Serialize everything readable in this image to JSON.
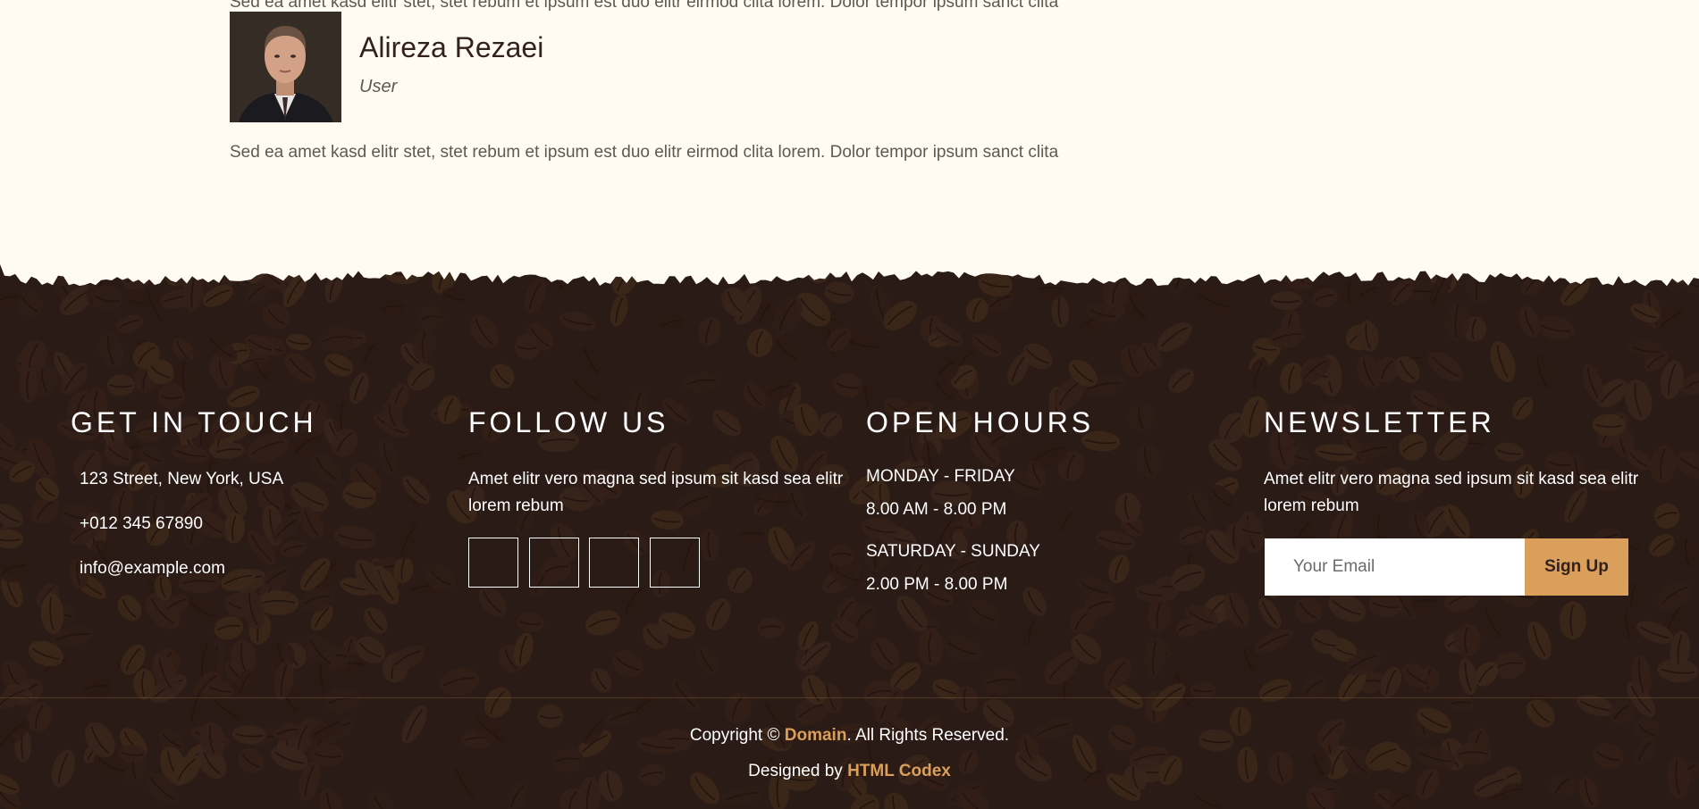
{
  "testimonial": {
    "cut_text": "Sed ea amet kasd elitr stet, stet rebum et ipsum est duo elitr eirmod clita lorem. Dolor tempor ipsum sanct clita",
    "author_name": "Alireza Rezaei",
    "author_role": "User",
    "review": "Sed ea amet kasd elitr stet, stet rebum et ipsum est duo elitr eirmod clita lorem. Dolor tempor ipsum sanct clita"
  },
  "footer": {
    "contact": {
      "title": "GET IN TOUCH",
      "address": "123 Street, New York, USA",
      "phone": "+012 345 67890",
      "email": "info@example.com"
    },
    "follow": {
      "title": "FOLLOW US",
      "text": "Amet elitr vero magna sed ipsum sit kasd sea elitr lorem rebum",
      "socials": [
        "twitter-icon",
        "facebook-icon",
        "linkedin-icon",
        "instagram-icon"
      ]
    },
    "hours": {
      "title": "OPEN HOURS",
      "weekday_label": "MONDAY - FRIDAY",
      "weekday_time": "8.00 AM - 8.00 PM",
      "weekend_label": "SATURDAY - SUNDAY",
      "weekend_time": "2.00 PM - 8.00 PM"
    },
    "newsletter": {
      "title": "NEWSLETTER",
      "text": "Amet elitr vero magna sed ipsum sit kasd sea elitr lorem rebum",
      "email_placeholder": "Your Email",
      "button_label": "Sign Up"
    },
    "copyright": {
      "prefix": "Copyright © ",
      "domain": "Domain",
      "suffix": ". All Rights Reserved.",
      "designed_prefix": "Designed by ",
      "designer": "HTML Codex"
    }
  },
  "colors": {
    "page_bg": "#FFFBF2",
    "footer_bg": "#2c1c17",
    "accent": "#DA9F5B",
    "dark_text": "#33211D"
  }
}
